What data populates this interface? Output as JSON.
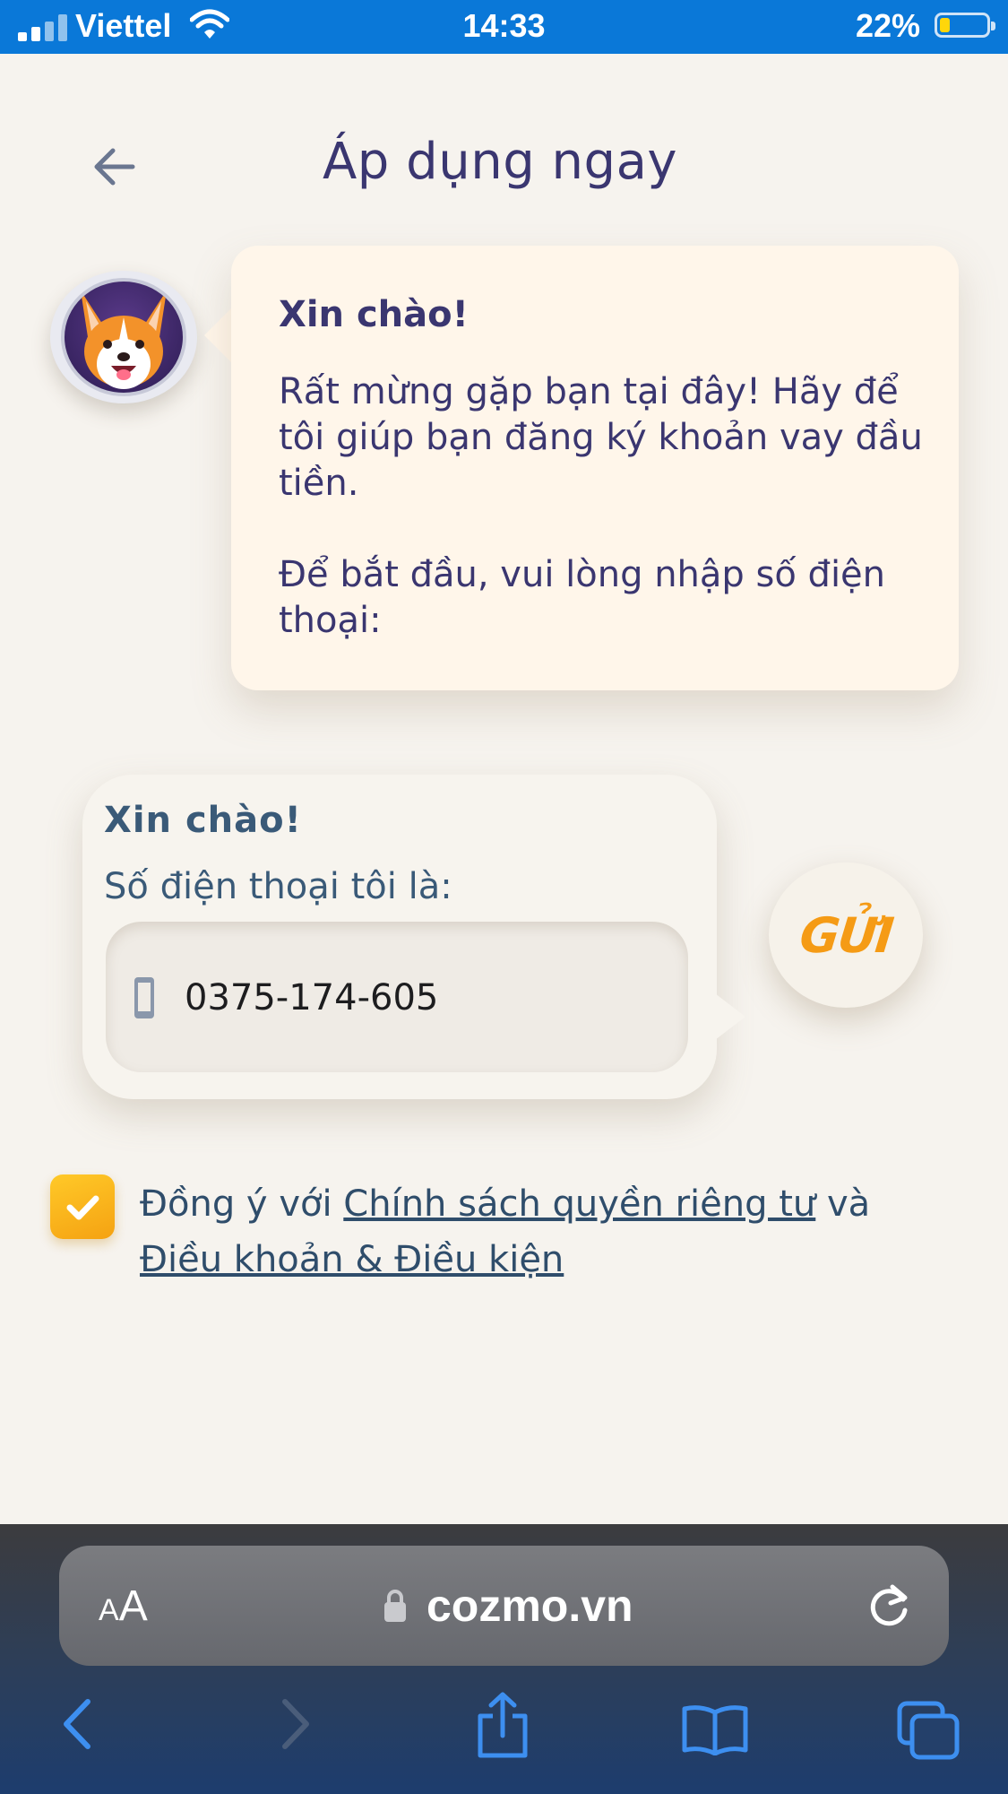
{
  "status_bar": {
    "carrier": "Viettel",
    "time": "14:33",
    "battery_percent": "22%",
    "battery_level": 0.22,
    "signal_icon": "cellular-signal-icon",
    "wifi_icon": "wifi-icon"
  },
  "header": {
    "back_icon": "back-arrow-icon",
    "title": "Áp dụng ngay"
  },
  "bot_message": {
    "avatar": "corgi-astronaut-avatar",
    "greeting": "Xin chào!",
    "paragraph_1": "Rất mừng gặp bạn tại đây! Hãy để tôi giúp bạn đăng ký khoản vay đầu tiền.",
    "paragraph_2": "Để bắt đầu, vui lòng nhập số điện thoại:"
  },
  "user_message": {
    "greeting": "Xin chào!",
    "phone_label": "Số điện thoại tôi là:",
    "phone_icon": "mobile-phone-icon",
    "phone_value": "0375-174-605"
  },
  "send_button": {
    "label": "GỬI"
  },
  "consent": {
    "checked": true,
    "prefix": "Đồng ý với ",
    "privacy_link": "Chính sách quyền riêng tư",
    "joiner": " và",
    "terms_link": "Điều khoản & Điều kiện"
  },
  "browser": {
    "text_size_big": "A",
    "text_size_small": "A",
    "url": "cozmo.vn",
    "lock_icon": "lock-icon",
    "reload_icon": "reload-icon",
    "toolbar": [
      "back-icon",
      "forward-icon",
      "share-icon",
      "bookmarks-icon",
      "tabs-icon"
    ]
  },
  "colors": {
    "status_bar": "#0a78d8",
    "page_background": "#f6f3ee",
    "title_text": "#3a3670",
    "bot_bubble": "#fff6ea",
    "accent_orange": "#f59b15",
    "checkbox": "#ffc928",
    "toolbar_icons": "#3d8ff0"
  }
}
